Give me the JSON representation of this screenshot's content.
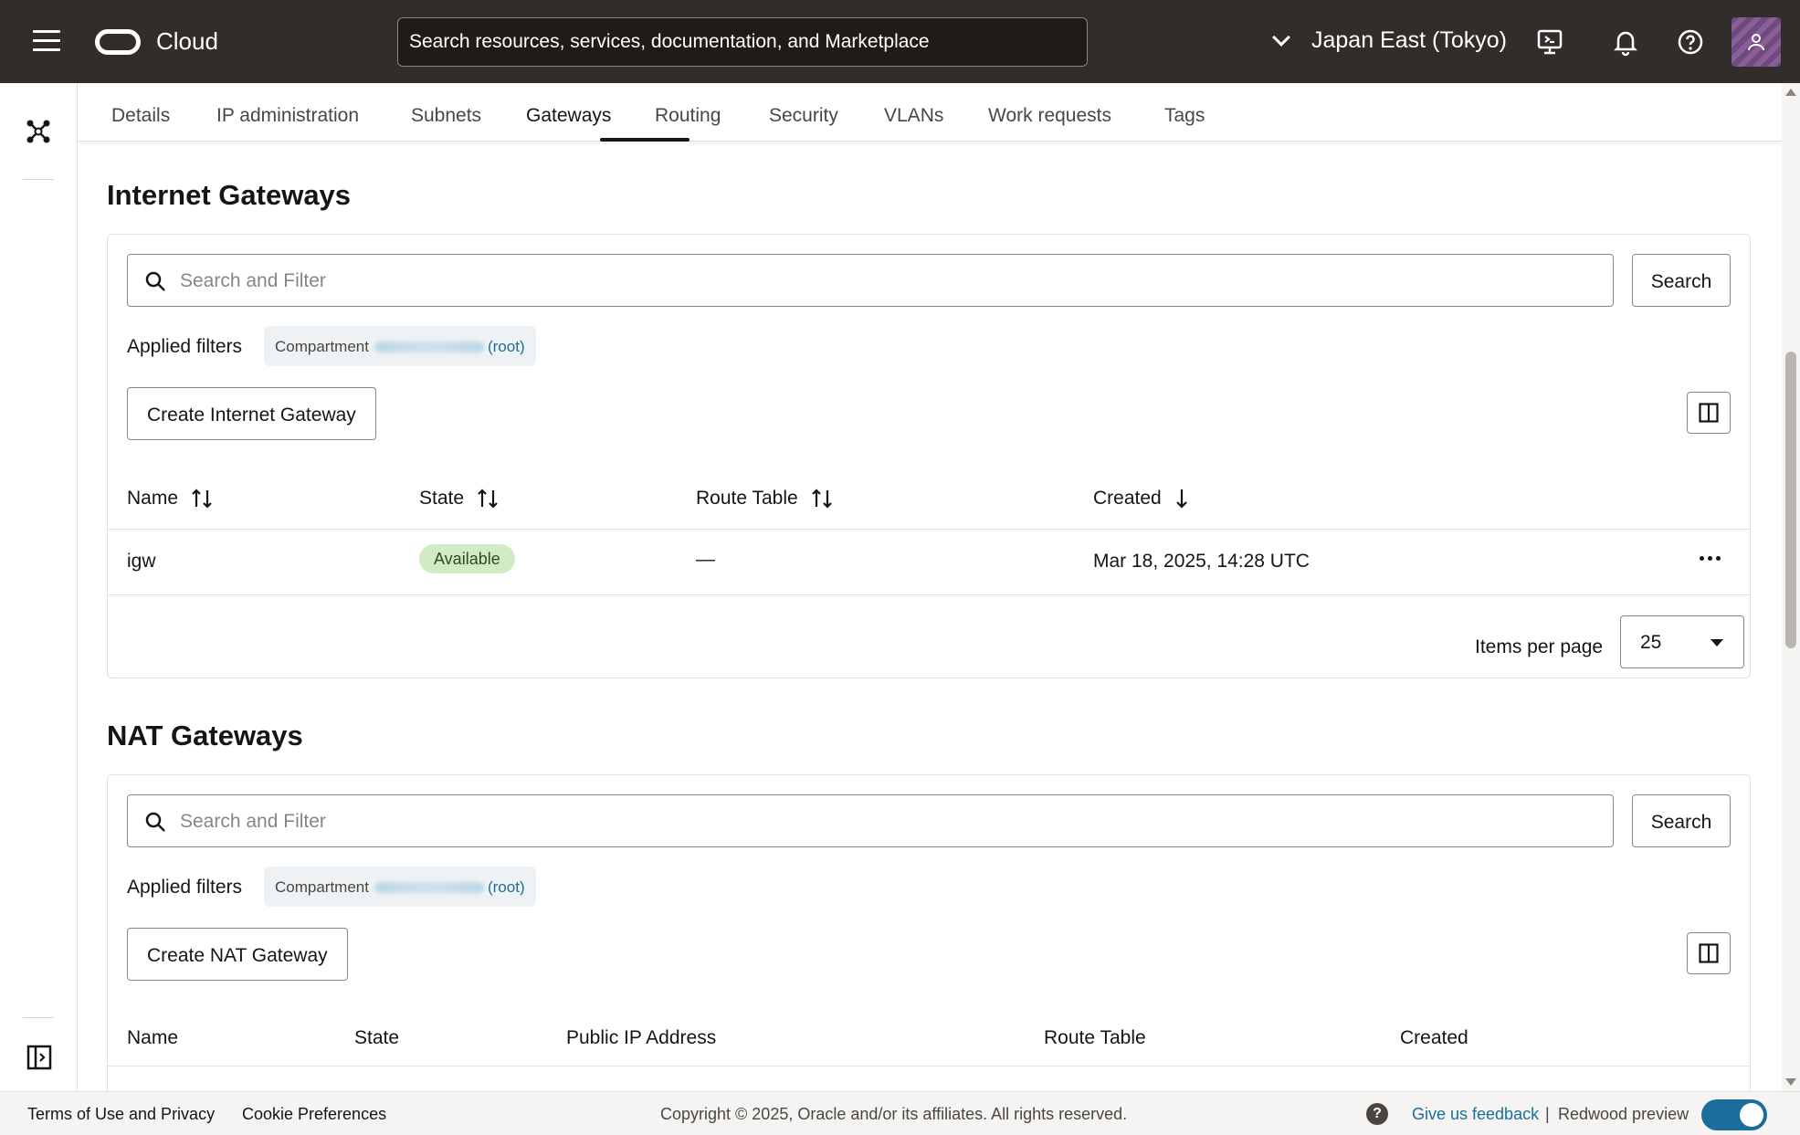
{
  "header": {
    "cloud_label": "Cloud",
    "search_placeholder": "Search resources, services, documentation, and Marketplace",
    "region": "Japan East (Tokyo)",
    "icons": [
      "menu-icon",
      "oracle-logo",
      "chevron-down-icon",
      "cloud-shell-icon",
      "bell-icon",
      "help-icon",
      "avatar"
    ]
  },
  "leftrail": {
    "icons": [
      "network-topology-icon",
      "expand-panel-icon"
    ]
  },
  "tabs": [
    {
      "label": "Details"
    },
    {
      "label": "IP administration"
    },
    {
      "label": "Subnets"
    },
    {
      "label": "Gateways",
      "active": true
    },
    {
      "label": "Routing"
    },
    {
      "label": "Security"
    },
    {
      "label": "VLANs"
    },
    {
      "label": "Work requests"
    },
    {
      "label": "Tags"
    }
  ],
  "internet_gateways": {
    "title": "Internet Gateways",
    "search_placeholder": "Search and Filter",
    "search_button": "Search",
    "applied_filters_label": "Applied filters",
    "filter_chip": {
      "label": "Compartment",
      "value_suffix": "(root)"
    },
    "create_button": "Create Internet Gateway",
    "columns": [
      "Name",
      "State",
      "Route Table",
      "Created"
    ],
    "rows": [
      {
        "name": "igw",
        "state": "Available",
        "route_table": "—",
        "created": "Mar 18, 2025, 14:28 UTC"
      }
    ],
    "items_per_page_label": "Items per page",
    "items_per_page": "25"
  },
  "nat_gateways": {
    "title": "NAT Gateways",
    "search_placeholder": "Search and Filter",
    "search_button": "Search",
    "applied_filters_label": "Applied filters",
    "filter_chip": {
      "label": "Compartment",
      "value_suffix": "(root)"
    },
    "create_button": "Create NAT Gateway",
    "columns": [
      "Name",
      "State",
      "Public IP Address",
      "Route Table",
      "Created"
    ]
  },
  "footer": {
    "terms": "Terms of Use and Privacy",
    "cookies": "Cookie Preferences",
    "copyright": "Copyright © 2025, Oracle and/or its affiliates. All rights reserved.",
    "feedback": "Give us feedback",
    "separator": "|",
    "redwood": "Redwood preview",
    "redwood_enabled": true
  },
  "colors": {
    "header_bg": "#312d2a",
    "link": "#1b6e9c",
    "available_badge": "#d1ecc4"
  }
}
